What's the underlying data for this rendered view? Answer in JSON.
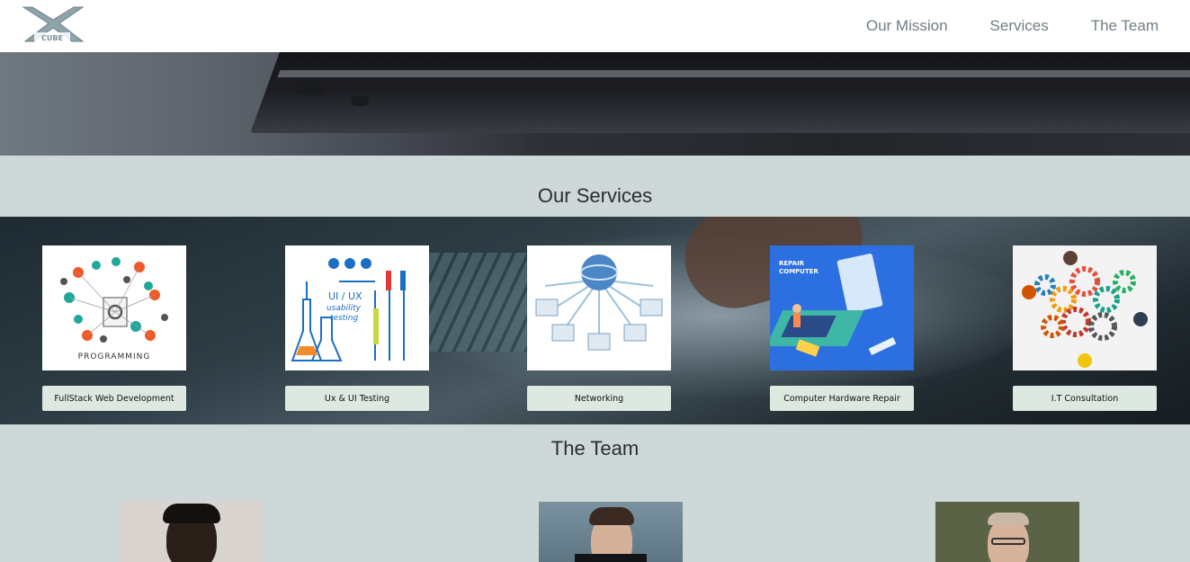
{
  "nav": {
    "logo_text": "X CUBE",
    "links": [
      "Our Mission",
      "Services",
      "The Team"
    ]
  },
  "services": {
    "title": "Our Services",
    "items": [
      {
        "label": "FullStack Web Development",
        "image_caption": "PROGRAMMING",
        "icon": "programming-illustration"
      },
      {
        "label": "Ux & UI Testing",
        "image_caption": "UI / UX usability testing",
        "icon": "ux-testing-illustration"
      },
      {
        "label": "Networking",
        "icon": "network-illustration"
      },
      {
        "label": "Computer Hardware Repair",
        "image_caption": "REPAIR COMPUTER",
        "icon": "hardware-repair-illustration"
      },
      {
        "label": "I.T Consultation",
        "icon": "consultation-gears-illustration"
      }
    ]
  },
  "team": {
    "title": "The Team",
    "members": [
      {
        "photo": "team-member-photo"
      },
      {
        "photo": "team-member-photo"
      },
      {
        "photo": "team-member-photo"
      }
    ]
  },
  "colors": {
    "nav_link": "#6e7f86",
    "page_bg": "#cfd8d8",
    "button_bg": "#dde8e1"
  }
}
